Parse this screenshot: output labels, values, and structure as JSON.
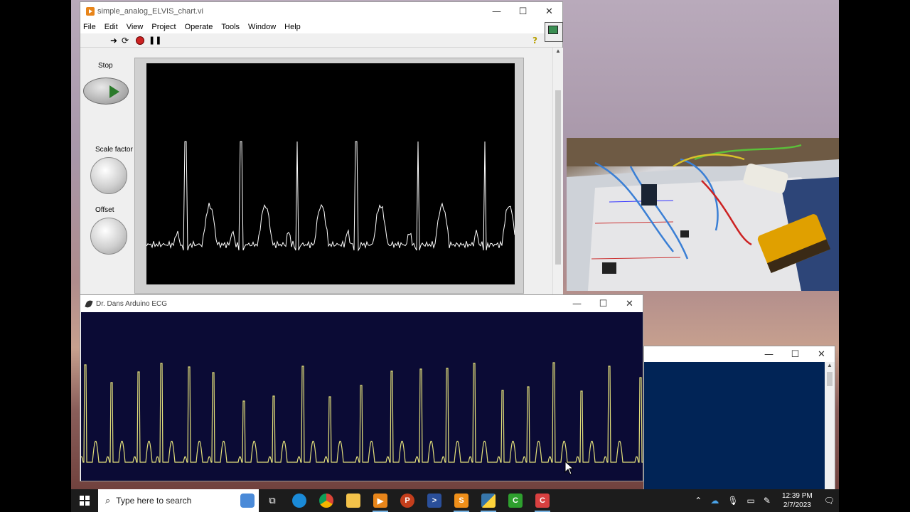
{
  "labview": {
    "title": "simple_analog_ELVIS_chart.vi",
    "menu": [
      "File",
      "Edit",
      "View",
      "Project",
      "Operate",
      "Tools",
      "Window",
      "Help"
    ],
    "controls": {
      "stop_label": "Stop",
      "scale_label": "Scale factor",
      "offset_label": "Offset"
    }
  },
  "ecg_app": {
    "title": "Dr. Dans Arduino ECG"
  },
  "window_controls": {
    "minimize": "—",
    "maximize": "☐",
    "close": "✕"
  },
  "taskbar": {
    "search_placeholder": "Type here to search",
    "apps": [
      "task-view",
      "edge",
      "chrome",
      "file-explorer",
      "vlc",
      "powerpoint",
      "powershell",
      "sublime-text",
      "python",
      "camtasia",
      "camtasia-recorder"
    ],
    "time": "12:39 PM",
    "date": "2/7/2023"
  },
  "colors": {
    "lv_trace": "#ffffff",
    "ecg_trace": "#e3e07a",
    "ecg_bg": "#0b0b35",
    "console_bg": "#012456"
  }
}
